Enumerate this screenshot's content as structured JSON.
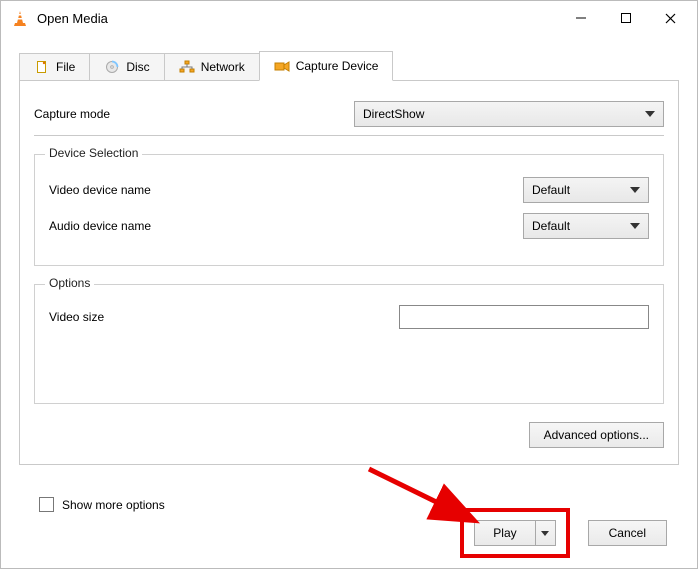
{
  "window": {
    "title": "Open Media"
  },
  "tabs": {
    "file": "File",
    "disc": "Disc",
    "network": "Network",
    "capture": "Capture Device"
  },
  "capture": {
    "mode_label": "Capture mode",
    "mode_value": "DirectShow"
  },
  "device_selection": {
    "legend": "Device Selection",
    "video_label": "Video device name",
    "video_value": "Default",
    "audio_label": "Audio device name",
    "audio_value": "Default"
  },
  "options": {
    "legend": "Options",
    "video_size_label": "Video size",
    "video_size_value": ""
  },
  "advanced_label": "Advanced options...",
  "show_more_label": "Show more options",
  "play_label": "Play",
  "cancel_label": "Cancel"
}
